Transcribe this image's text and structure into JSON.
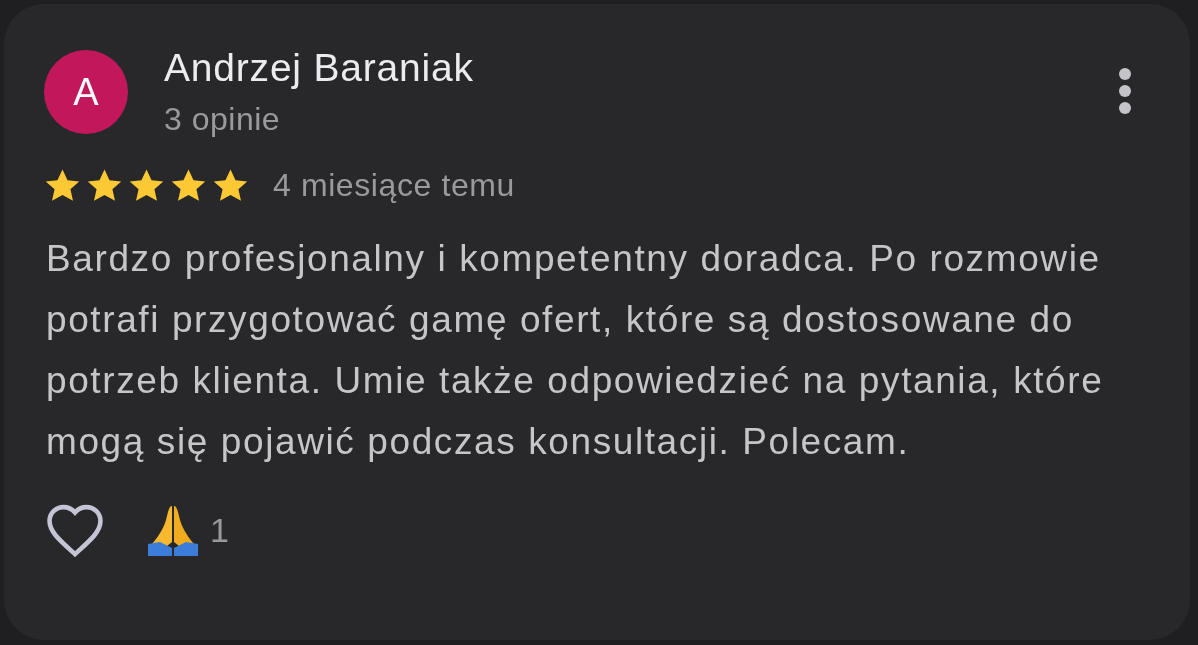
{
  "review": {
    "avatar_letter": "A",
    "author": "Andrzej Baraniak",
    "reviews_count": "3 opinie",
    "stars": 5,
    "date": "4 miesiące temu",
    "text": "Bardzo profesjonalny i kompetentny doradca. Po rozmowie potrafi przygotować gamę ofert, które są dostosowane do potrzeb klienta. Umie także odpowiedzieć na pytania, które mogą się pojawić podczas konsultacji. Polecam.",
    "liked": false,
    "reaction_count": "1"
  }
}
